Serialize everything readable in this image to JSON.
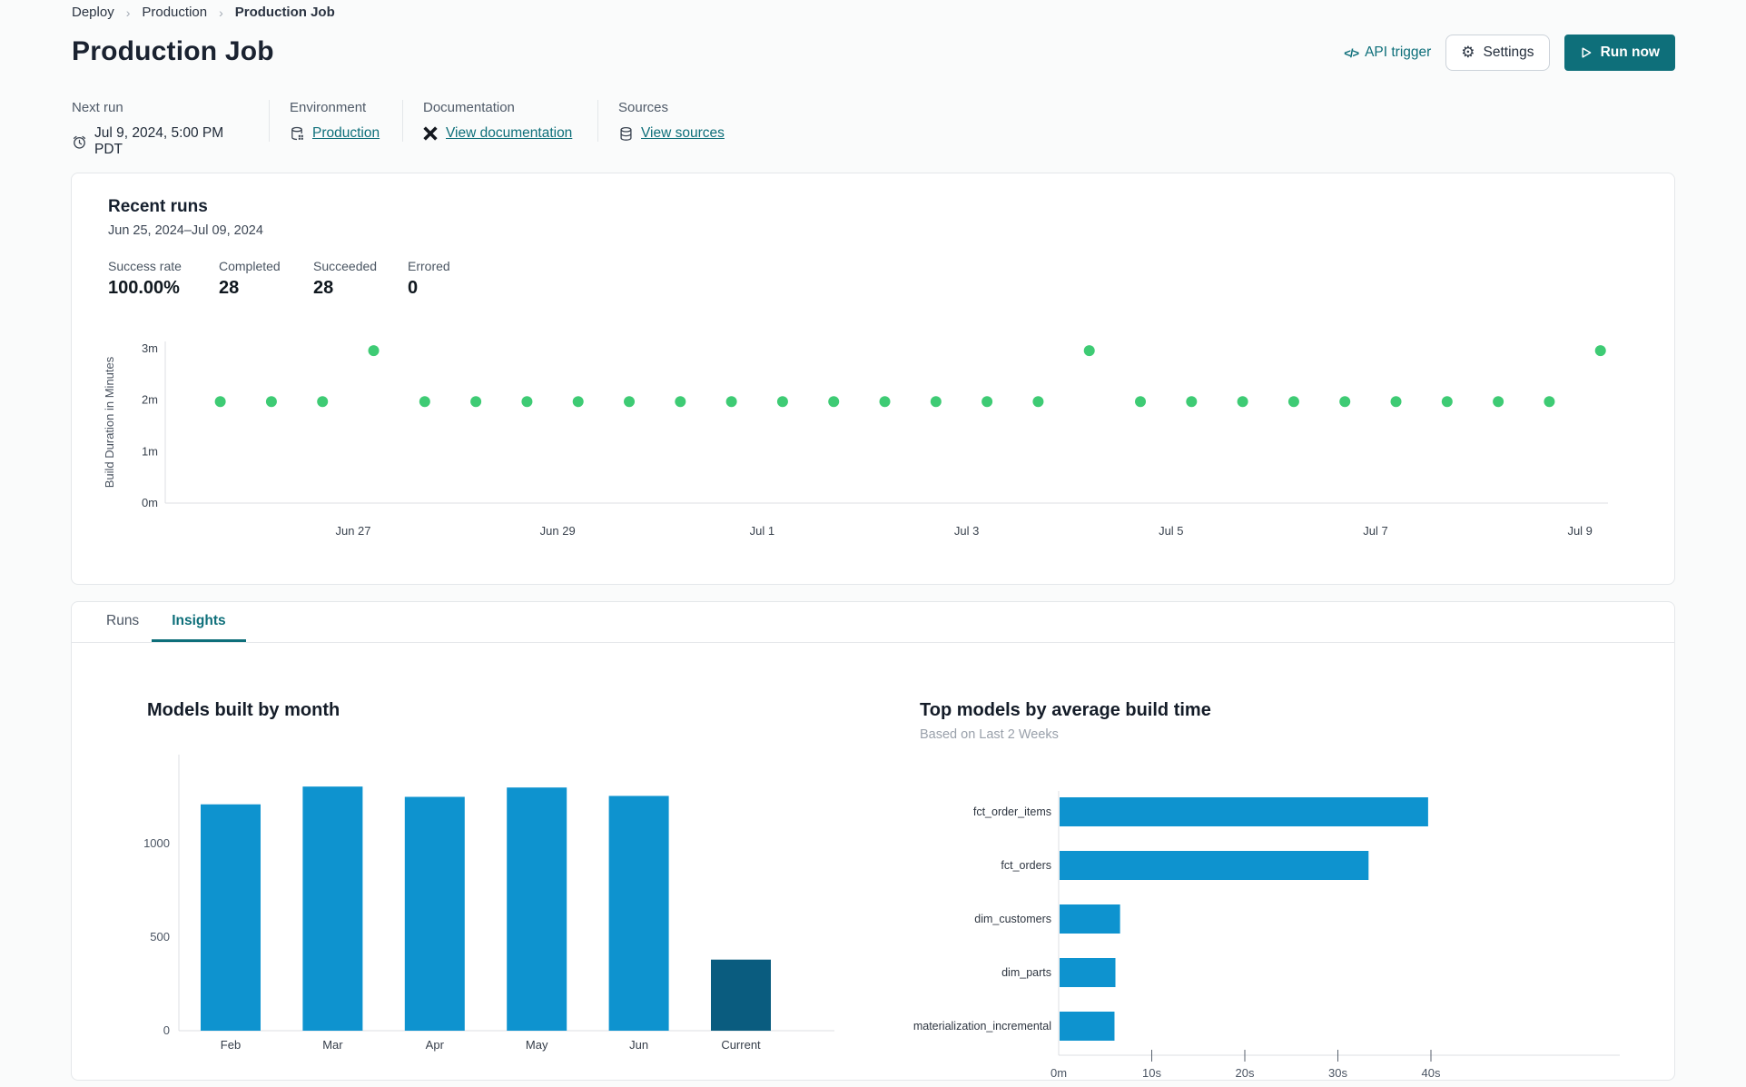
{
  "breadcrumb": {
    "items": [
      "Deploy",
      "Production",
      "Production Job"
    ],
    "separator": "›"
  },
  "header": {
    "title": "Production Job",
    "api_trigger_label": "API trigger",
    "api_trigger_icon": "</>",
    "settings_label": "Settings",
    "run_now_label": "Run now"
  },
  "meta": {
    "next_run": {
      "label": "Next run",
      "value": "Jul 9, 2024, 5:00 PM PDT",
      "icon": "alarm-clock-icon"
    },
    "environment": {
      "label": "Environment",
      "value": "Production",
      "icon": "environment-database-icon"
    },
    "documentation": {
      "label": "Documentation",
      "value": "View documentation",
      "icon": "dbt-docs-icon"
    },
    "sources": {
      "label": "Sources",
      "value": "View sources",
      "icon": "database-icon"
    }
  },
  "recent_runs": {
    "title": "Recent runs",
    "date_range": "Jun 25, 2024–Jul 09, 2024",
    "stats": [
      {
        "label": "Success rate",
        "value": "100.00%"
      },
      {
        "label": "Completed",
        "value": "28"
      },
      {
        "label": "Succeeded",
        "value": "28"
      },
      {
        "label": "Errored",
        "value": "0"
      }
    ]
  },
  "tabs": [
    {
      "label": "Runs",
      "active": false
    },
    {
      "label": "Insights",
      "active": true
    }
  ],
  "colors": {
    "teal": "#0e6f7a",
    "bar_blue": "#0e93cf",
    "bar_dark": "#0a5c7f",
    "dot_green": "#3ecb74",
    "axis_line": "#dcdfe3",
    "tick_text": "#39424e",
    "muted_text": "#4b5563"
  },
  "chart_data": [
    {
      "id": "build-duration-scatter",
      "type": "scatter",
      "title": "Recent runs",
      "ylabel": "Build Duration in Minutes",
      "yticks": [
        {
          "label": "0m",
          "minutes": 0
        },
        {
          "label": "1m",
          "minutes": 1
        },
        {
          "label": "2m",
          "minutes": 2
        },
        {
          "label": "3m",
          "minutes": 3
        }
      ],
      "ylim": [
        0,
        3.2
      ],
      "xticks": [
        {
          "label": "Jun 27",
          "day": 2
        },
        {
          "label": "Jun 29",
          "day": 4
        },
        {
          "label": "Jul 1",
          "day": 6
        },
        {
          "label": "Jul 3",
          "day": 8
        },
        {
          "label": "Jul 5",
          "day": 10
        },
        {
          "label": "Jul 7",
          "day": 12
        },
        {
          "label": "Jul 9",
          "day": 14
        }
      ],
      "x_start_day": 0.7,
      "x_interval_days": 0.5,
      "durations_minutes": [
        1.97,
        1.97,
        1.97,
        2.96,
        1.97,
        1.97,
        1.97,
        1.97,
        1.97,
        1.97,
        1.97,
        1.97,
        1.97,
        1.97,
        1.97,
        1.97,
        1.97,
        2.96,
        1.97,
        1.97,
        1.97,
        1.97,
        1.97,
        1.97,
        1.97,
        1.97,
        1.97,
        2.96
      ],
      "point_color": "#3ecb74"
    },
    {
      "id": "models-built-by-month",
      "type": "bar",
      "title": "Models built by month",
      "categories": [
        "Feb",
        "Mar",
        "Apr",
        "May",
        "Jun",
        "Current"
      ],
      "values": [
        1210,
        1305,
        1250,
        1300,
        1255,
        380
      ],
      "yticks": [
        0,
        500,
        1000
      ],
      "ylim": [
        0,
        1400
      ],
      "bar_color": "#0e93cf",
      "current_bar_color": "#0a5c7f"
    },
    {
      "id": "top-models-by-average-build-time",
      "type": "bar-horizontal",
      "title": "Top models by average build time",
      "subtitle": "Based on Last 2 Weeks",
      "categories": [
        "fct_order_items",
        "fct_orders",
        "dim_customers",
        "dim_parts",
        "materialization_incremental"
      ],
      "values_seconds": [
        39.6,
        33.2,
        6.5,
        6.0,
        5.9
      ],
      "xticks": [
        {
          "label": "0m",
          "seconds": 0
        },
        {
          "label": "10s",
          "seconds": 10
        },
        {
          "label": "20s",
          "seconds": 20
        },
        {
          "label": "30s",
          "seconds": 30
        },
        {
          "label": "40s",
          "seconds": 40
        }
      ],
      "xlim": [
        0,
        43
      ],
      "bar_color": "#0e93cf"
    }
  ]
}
